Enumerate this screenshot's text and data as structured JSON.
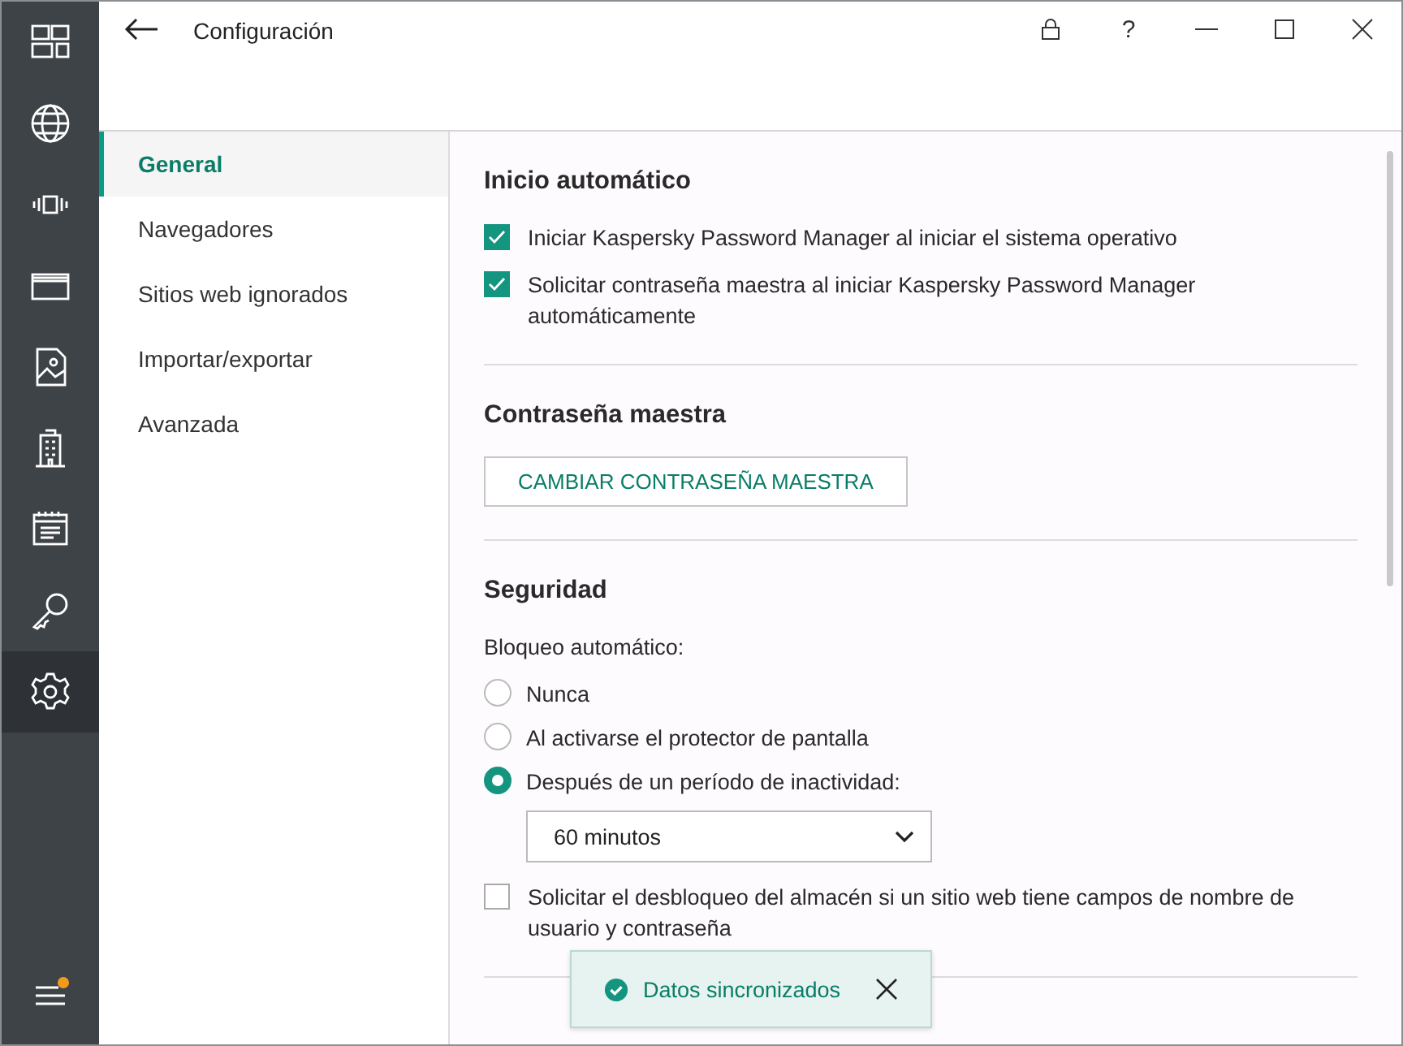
{
  "window": {
    "title": "Configuración",
    "help": "?"
  },
  "rail": [
    {
      "kind": "tiles",
      "selected": false
    },
    {
      "kind": "globe",
      "selected": false
    },
    {
      "kind": "device",
      "selected": false
    },
    {
      "kind": "card",
      "selected": false
    },
    {
      "kind": "image",
      "selected": false
    },
    {
      "kind": "building",
      "selected": false
    },
    {
      "kind": "note",
      "selected": false
    },
    {
      "kind": "key",
      "selected": false
    },
    {
      "kind": "gear",
      "selected": true
    }
  ],
  "menu": {
    "badge": true
  },
  "nav": [
    {
      "label": "General",
      "selected": true
    },
    {
      "label": "Navegadores",
      "selected": false
    },
    {
      "label": "Sitios web ignorados",
      "selected": false
    },
    {
      "label": "Importar/exportar",
      "selected": false
    },
    {
      "label": "Avanzada",
      "selected": false
    }
  ],
  "sections": [
    {
      "title": "Inicio automático",
      "items": [
        {
          "kind": "checkbox",
          "label": "Iniciar Kaspersky Password Manager al iniciar el sistema operativo",
          "checked": true
        },
        {
          "kind": "checkbox",
          "label": "Solicitar contraseña maestra al iniciar Kaspersky Password Manager automáticamente",
          "checked": true
        }
      ]
    },
    {
      "title": "Contraseña maestra",
      "items": [
        {
          "kind": "button",
          "label": "CAMBIAR CONTRASEÑA MAESTRA"
        }
      ]
    },
    {
      "title": "Seguridad",
      "items": [
        {
          "kind": "label",
          "label": "Bloqueo automático:"
        },
        {
          "kind": "radio",
          "label": "Nunca",
          "selected": false
        },
        {
          "kind": "radio",
          "label": "Al activarse el protector de pantalla",
          "selected": false
        },
        {
          "kind": "radio",
          "label": "Después de un período de inactividad:",
          "selected": true
        },
        {
          "kind": "select",
          "value": "60 minutos"
        },
        {
          "kind": "checkbox",
          "label": "Solicitar el desbloqueo del almacén si un sitio web tiene campos de nombre de usuario y contraseña",
          "checked": false
        }
      ]
    }
  ],
  "toast": {
    "text": "Datos sincronizados"
  }
}
